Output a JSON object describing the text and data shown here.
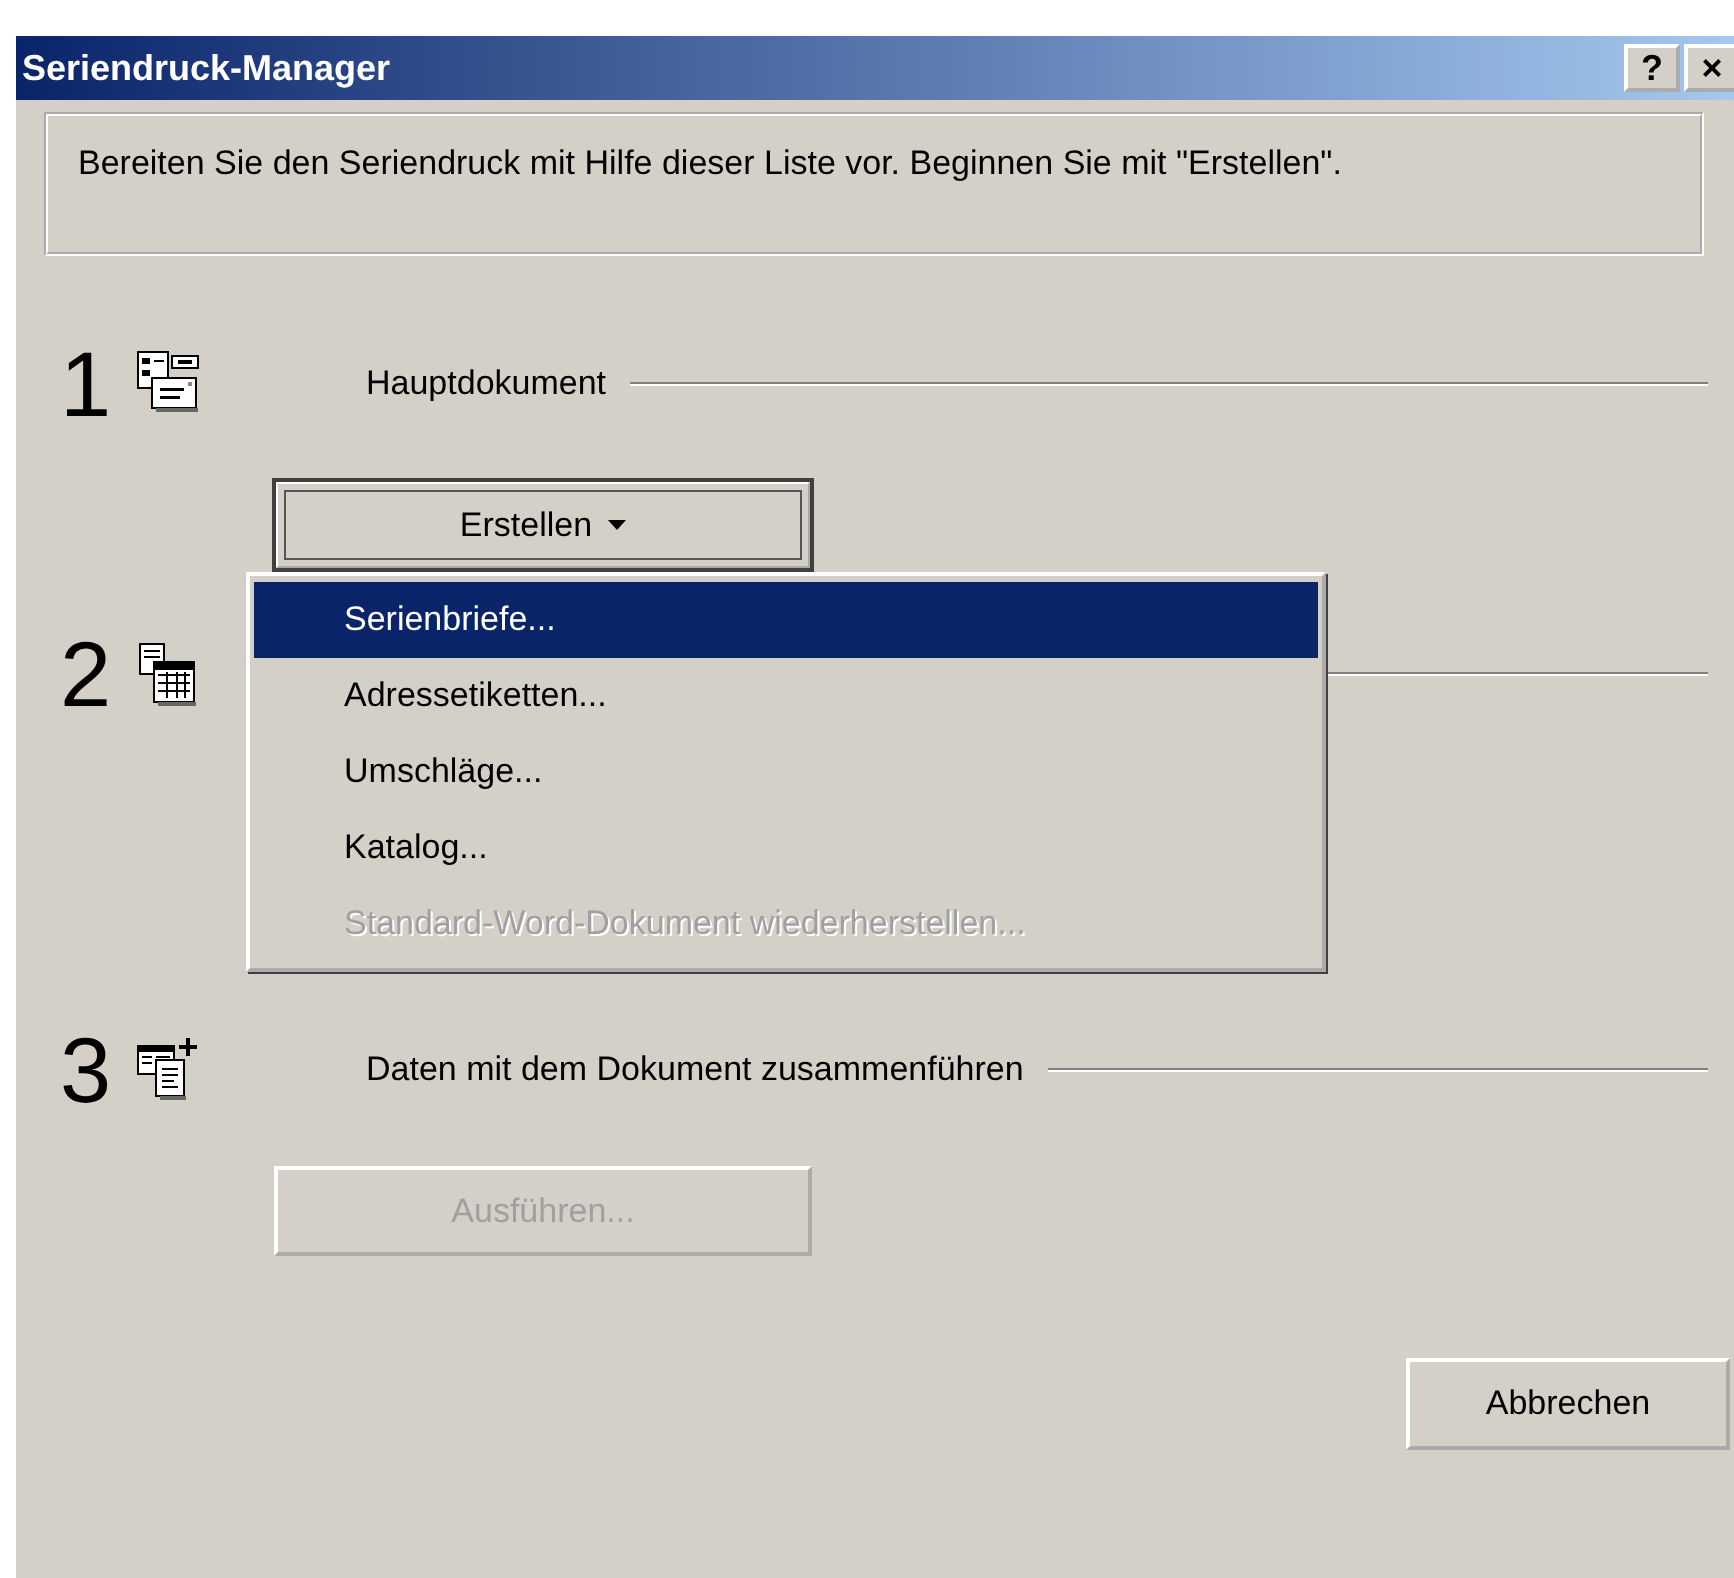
{
  "window": {
    "title": "Seriendruck-Manager",
    "help_button": "?",
    "close_button": "×"
  },
  "intro": "Bereiten Sie den Seriendruck mit Hilfe dieser Liste vor. Beginnen Sie mit \"Erstellen\".",
  "steps": [
    {
      "number": "1",
      "heading": "Hauptdokument",
      "button": {
        "label": "Erstellen",
        "disabled": false,
        "focused": true,
        "dropdown": true
      }
    },
    {
      "number": "2"
    },
    {
      "number": "3",
      "heading": "Daten mit dem Dokument zusammenführen",
      "button": {
        "label": "Ausführen...",
        "disabled": true,
        "focused": false,
        "dropdown": false
      }
    }
  ],
  "menu": [
    {
      "label": "Serienbriefe...",
      "selected": true,
      "disabled": false
    },
    {
      "label": "Adressetiketten...",
      "selected": false,
      "disabled": false
    },
    {
      "label": "Umschläge...",
      "selected": false,
      "disabled": false
    },
    {
      "label": "Katalog...",
      "selected": false,
      "disabled": false
    },
    {
      "label": "Standard-Word-Dokument wiederherstellen...",
      "selected": false,
      "disabled": true
    }
  ],
  "footer_buttons": [
    "Abbrechen"
  ]
}
